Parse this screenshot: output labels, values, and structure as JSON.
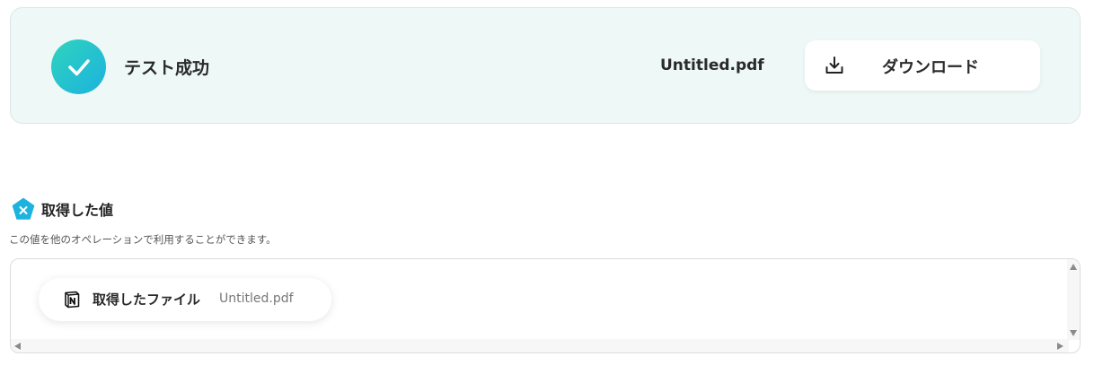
{
  "result": {
    "status_label": "テスト成功",
    "file_name": "Untitled.pdf",
    "download_label": "ダウンロード",
    "success_icon": "check-circle-icon",
    "accent_gradient": [
      "#2fd3bd",
      "#1cb3de"
    ]
  },
  "section": {
    "title": "取得した値",
    "description": "この値を他のオペレーションで利用することができます。",
    "icon": "variable-pentagon-icon",
    "icon_color": "#1cb3de"
  },
  "values": [
    {
      "label": "取得したファイル",
      "value": "Untitled.pdf",
      "icon": "notion-icon"
    }
  ]
}
